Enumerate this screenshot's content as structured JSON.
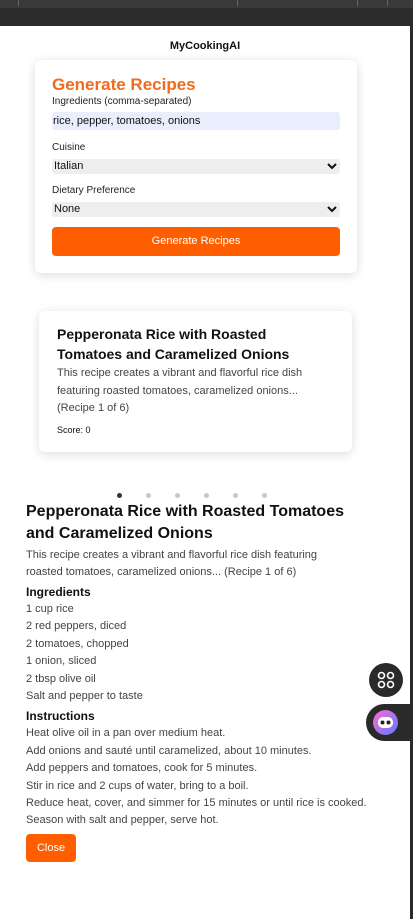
{
  "app": {
    "title": "MyCookingAI"
  },
  "form": {
    "title": "Generate Recipes",
    "ingredients_label": "Ingredients (comma-separated)",
    "ingredients_value": "rice, pepper, tomatoes, onions",
    "cuisine_label": "Cuisine",
    "cuisine_value": "Italian",
    "diet_label": "Dietary Preference",
    "diet_value": "None",
    "submit_label": "Generate Recipes"
  },
  "card": {
    "title": "Pepperonata Rice with Roasted Tomatoes and Caramelized Onions",
    "description": "This recipe creates a vibrant and flavorful rice dish featuring roasted tomatoes, caramelized onions... (Recipe 1 of 6)",
    "score": "Score: 0"
  },
  "carousel": {
    "total": 6,
    "active": 0
  },
  "detail": {
    "title": "Pepperonata Rice with Roasted Tomatoes and Caramelized Onions",
    "description": "This recipe creates a vibrant and flavorful rice dish featuring roasted tomatoes, caramelized onions... (Recipe 1 of 6)",
    "ingredients_heading": "Ingredients",
    "ingredients": [
      "1 cup rice",
      "2 red peppers, diced",
      "2 tomatoes, chopped",
      "1 onion, sliced",
      "2 tbsp olive oil",
      "Salt and pepper to taste"
    ],
    "instructions_heading": "Instructions",
    "instructions": [
      "Heat olive oil in a pan over medium heat.",
      "Add onions and sauté until caramelized, about 10 minutes.",
      "Add peppers and tomatoes, cook for 5 minutes.",
      "Stir in rice and 2 cups of water, bring to a boil.",
      "Reduce heat, cover, and simmer for 15 minutes or until rice is cooked.",
      "Season with salt and pepper, serve hot."
    ],
    "close_label": "Close"
  },
  "icons": {
    "chevron": "chevron-down-icon",
    "grid": "grid-icon",
    "bot": "bot-icon"
  },
  "colors": {
    "accent": "#ff5e00",
    "title_orange": "#f26a1b",
    "input_bg": "#e8eefb"
  }
}
